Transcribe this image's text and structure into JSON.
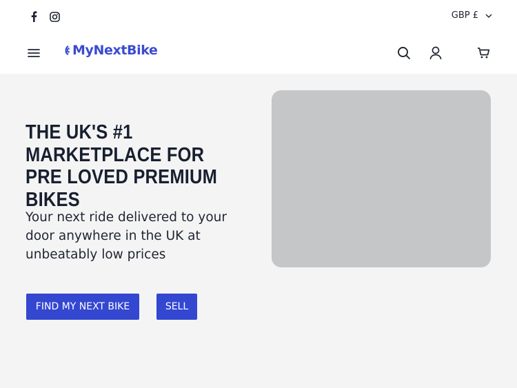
{
  "topbar": {
    "social": [
      {
        "name": "facebook-icon"
      },
      {
        "name": "instagram-icon"
      }
    ],
    "currency_label": "GBP £"
  },
  "navbar": {
    "brand_name": "MyNextBike",
    "icons": [
      "menu-icon",
      "search-icon",
      "account-icon",
      "cart-icon"
    ]
  },
  "hero": {
    "headline": "The UK's #1 marketplace for pre loved premium bikes",
    "subtext": "Your next ride delivered to your door anywhere in the UK at unbeatably low prices",
    "primary_button": "FIND MY NEXT BIKE",
    "secondary_button": "SELL"
  },
  "colors": {
    "brand": "#3347d1",
    "text_dark": "#18202f",
    "hero_bg": "#f4f4f5",
    "image_placeholder": "#c5c6c8"
  }
}
